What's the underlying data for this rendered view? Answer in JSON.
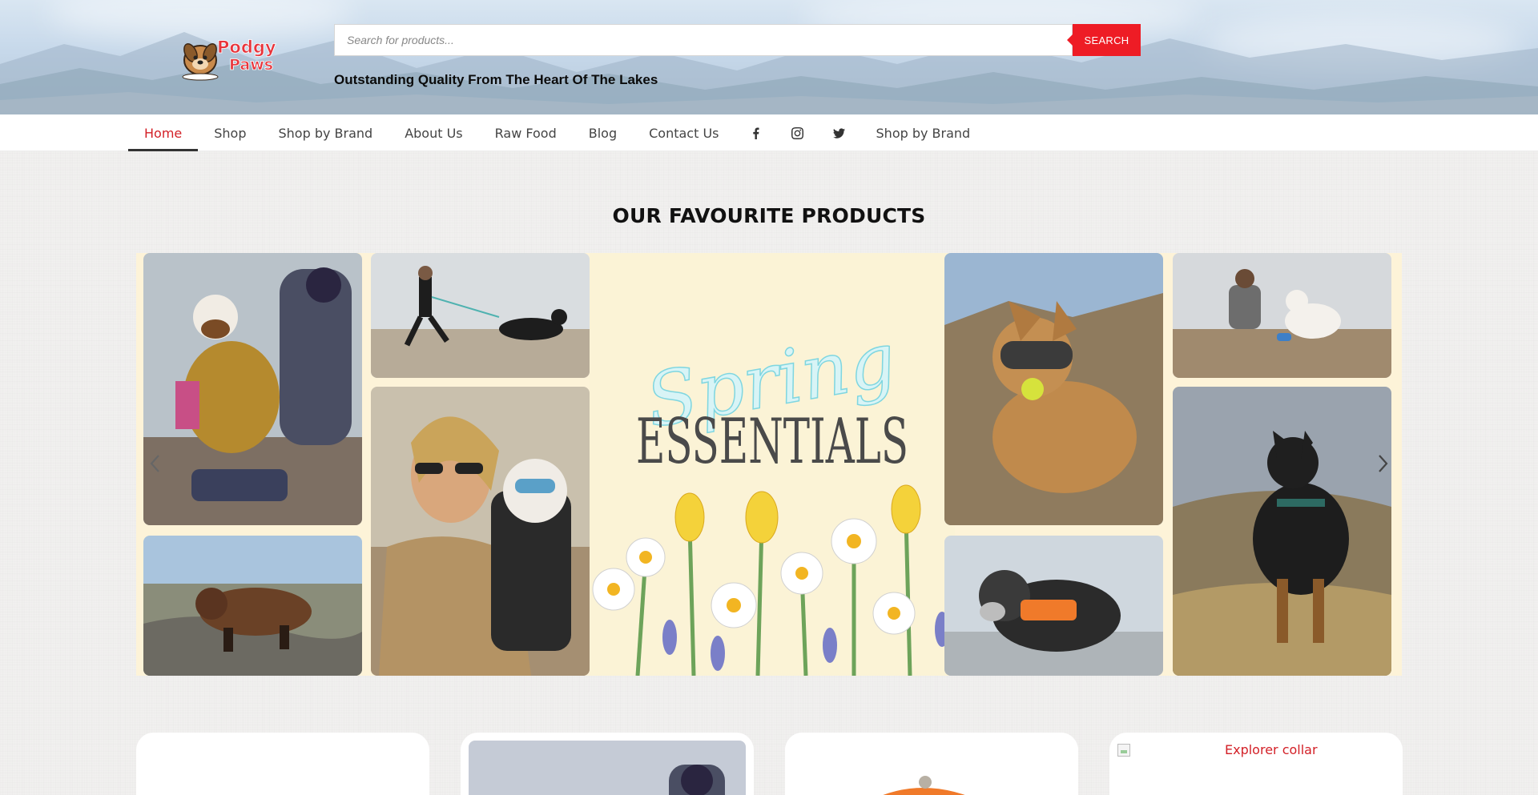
{
  "brand": {
    "logo_line1": "Podgy",
    "logo_line2": "Paws"
  },
  "search": {
    "placeholder": "Search for products...",
    "button_label": "SEARCH"
  },
  "tagline": "Outstanding Quality From The Heart Of The Lakes",
  "nav": {
    "items": [
      {
        "label": "Home",
        "active": true
      },
      {
        "label": "Shop"
      },
      {
        "label": "Shop by Brand"
      },
      {
        "label": "About Us"
      },
      {
        "label": "Raw Food"
      },
      {
        "label": "Blog"
      },
      {
        "label": "Contact Us"
      }
    ],
    "social": [
      "facebook-icon",
      "instagram-icon",
      "twitter-icon"
    ],
    "trailing_label": "Shop by Brand"
  },
  "section_title": "OUR FAVOURITE PRODUCTS",
  "banner": {
    "script_word": "Spring",
    "headline": "ESSENTIALS"
  },
  "products": [
    {
      "image_alt": ""
    },
    {
      "image_alt": ""
    },
    {
      "image_alt": ""
    },
    {
      "image_alt": "Explorer collar"
    }
  ],
  "colors": {
    "accent_red": "#ee1c25",
    "active_nav": "#d32027",
    "banner_bg": "#fdf3d8"
  }
}
